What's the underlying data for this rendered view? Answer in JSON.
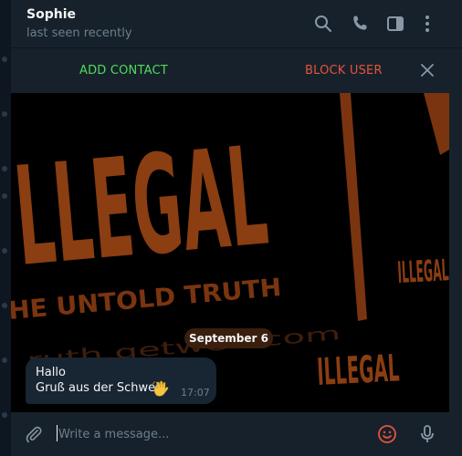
{
  "chat": {
    "name": "Sophie",
    "status": "last seen recently"
  },
  "header_icons": [
    "search-icon",
    "phone-icon",
    "sidebar-toggle-icon",
    "more-vertical-icon"
  ],
  "action_bar": {
    "add_contact": "ADD CONTACT",
    "block_user": "BLOCK USER"
  },
  "wallpaper": {
    "big_word": "LLEGAL",
    "subtitle": "HE UNTOLD TRUTH",
    "small_word": "ILLEGAL",
    "url_text": "ruth.getwe...com"
  },
  "date_separator": "September 6",
  "message": {
    "line1": "Hallo",
    "line2": "Gruß aus der Schweiz",
    "emoji": "waving-hand-emoji",
    "time": "17:07"
  },
  "composer": {
    "placeholder": "Write a message..."
  },
  "colors": {
    "accent_green": "#4fdb5c",
    "accent_red": "#e5533d",
    "wallpaper_orange": "#8a3e12",
    "panel": "#17212b",
    "bubble": "#182533"
  }
}
